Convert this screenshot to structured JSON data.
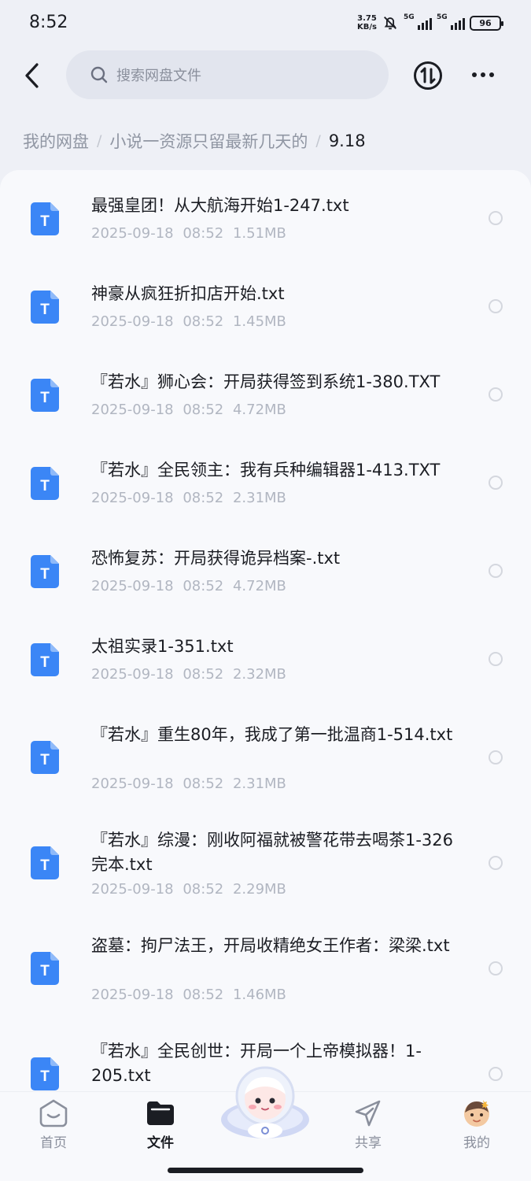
{
  "status_bar": {
    "time": "8:52",
    "net_speed_value": "3.75",
    "net_speed_unit": "KB/s",
    "signal_1": "5G",
    "signal_2": "5G",
    "battery": "96"
  },
  "header": {
    "search_placeholder": "搜索网盘文件",
    "back_icon": "chevron-left-icon",
    "transfer_icon": "transfer-icon",
    "more_icon": "more-horizontal-icon"
  },
  "breadcrumb": {
    "root": "我的网盘",
    "folder": "小说一资源只留最新几天的",
    "current": "9.18",
    "separator": "/"
  },
  "files": [
    {
      "name": "最强皇团！从大航海开始1-247.txt",
      "date": "2025-09-18",
      "time": "08:52",
      "size": "1.51MB"
    },
    {
      "name": "神豪从疯狂折扣店开始.txt",
      "date": "2025-09-18",
      "time": "08:52",
      "size": "1.45MB"
    },
    {
      "name": "『若水』狮心会：开局获得签到系统1-380.TXT",
      "date": "2025-09-18",
      "time": "08:52",
      "size": "4.72MB"
    },
    {
      "name": "『若水』全民领主：我有兵种编辑器1-413.TXT",
      "date": "2025-09-18",
      "time": "08:52",
      "size": "2.31MB"
    },
    {
      "name": "恐怖复苏：开局获得诡异档案-.txt",
      "date": "2025-09-18",
      "time": "08:52",
      "size": "4.72MB"
    },
    {
      "name": "太祖实录1-351.txt",
      "date": "2025-09-18",
      "time": "08:52",
      "size": "2.32MB"
    },
    {
      "name": "『若水』重生80年，我成了第一批温商1-514.txt",
      "date": "2025-09-18",
      "time": "08:52",
      "size": "2.31MB"
    },
    {
      "name": "『若水』综漫：刚收阿福就被警花带去喝茶1-326完本.txt",
      "date": "2025-09-18",
      "time": "08:52",
      "size": "2.29MB"
    },
    {
      "name": "盗墓：拘尸法王，开局收精绝女王作者：梁梁.txt",
      "date": "2025-09-18",
      "time": "08:52",
      "size": "1.46MB"
    },
    {
      "name": "『若水』全民创世：开局一个上帝模拟器！1-205.txt",
      "date": "",
      "time": "",
      "size": ""
    }
  ],
  "file_icon_letter": "T",
  "colors": {
    "accent": "#3b86f6",
    "background": "#eef0f6",
    "panel": "#f8f9fc",
    "meta_text": "#b1b6c1"
  },
  "bottom_nav": {
    "home": "首页",
    "files": "文件",
    "share": "共享",
    "mine": "我的",
    "active": "文件"
  }
}
